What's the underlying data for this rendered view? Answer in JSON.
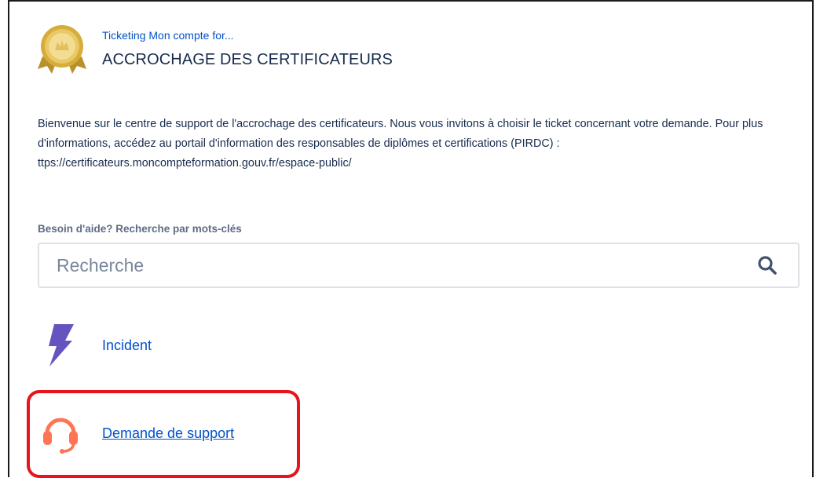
{
  "header": {
    "breadcrumb": "Ticketing Mon compte for...",
    "title": "ACCROCHAGE DES CERTIFICATEURS",
    "logo_icon": "gold-medal-icon"
  },
  "description": "Bienvenue sur le centre de support de l'accrochage des certificateurs. Nous vous invitons à choisir le ticket concernant votre demande. Pour plus d'informations, accédez au portail d'information des responsables de diplômes et certifications (PIRDC) : ttps://certificateurs.moncompteformation.gouv.fr/espace-public/",
  "search": {
    "label": "Besoin d'aide? Recherche par mots-clés",
    "placeholder": "Recherche",
    "value": "",
    "icon": "search-icon"
  },
  "request_types": [
    {
      "label": "Incident",
      "icon": "lightning-icon",
      "color": "#6554c0"
    },
    {
      "label": "Demande de support",
      "icon": "headset-icon",
      "color": "#ff7452"
    }
  ],
  "colors": {
    "link": "#0052cc",
    "text": "#172b4d",
    "highlight": "#e8141b",
    "logo_gold": "#d4a72c"
  }
}
